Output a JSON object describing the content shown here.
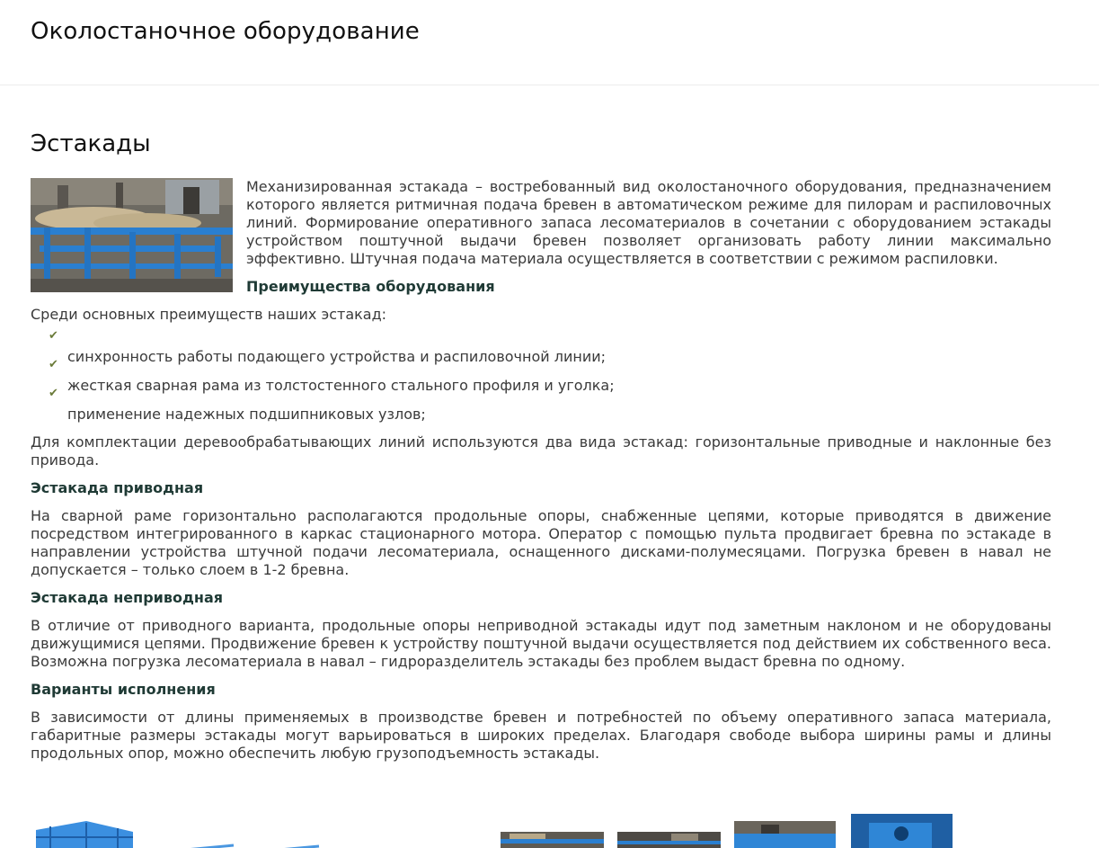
{
  "header": {
    "title": "Околостаночное оборудование"
  },
  "section": {
    "title": "Эстакады",
    "intro": "Механизированная эстакада – востребованный вид околостаночного оборудования, предназначением которого является ритмичная подача бревен в автоматическом режиме для пилорам и распиловочных линий. Формирование оперативного запаса лесоматериалов в сочетании с оборудованием эстакады устройством поштучной выдачи бревен позволяет организовать работу линии максимально эффективно. Штучная подача материала осуществляется в соответствии с режимом распиловки.",
    "advantages_title": "Преимущества оборудования",
    "advantages_lead": "Среди основных преимуществ наших эстакад:",
    "advantages": [
      "синхронность работы подающего устройства и распиловочной линии;",
      "жесткая сварная рама из толстостенного стального профиля и уголка;",
      "применение надежных подшипниковых узлов;"
    ],
    "types_text": "Для комплектации деревообрабатывающих линий используются два вида эстакад: горизонтальные приводные и наклонные без привода.",
    "driven_title": "Эстакада приводная",
    "driven_text": "На сварной раме горизонтально располагаются продольные опоры, снабженные цепями, которые приводятся в движение посредством интегрированного в каркас стационарного мотора. Оператор с помощью пульта продвигает бревна по эстакаде в направлении устройства штучной подачи лесоматериала, оснащенного дисками-полумесяцами. Погрузка бревен в навал не допускается – только слоем в 1-2 бревна.",
    "nondriven_title": "Эстакада неприводная",
    "nondriven_text": "В отличие от приводного варианта, продольные опоры неприводной эстакады идут под заметным наклоном и не оборудованы движущимися цепями. Продвижение бревен к устройству поштучной выдачи осуществляется под действием их собственного веса. Возможна погрузка лесоматериала в навал – гидроразделитель эстакады без проблем выдаст бревна по одному.",
    "variants_title": "Варианты исполнения",
    "variants_text": "В зависимости от длины применяемых в производстве бревен и потребностей по объему оперативного запаса материала, габаритные размеры эстакады могут варьироваться в широких пределах. Благодаря свободе выбора ширины рамы и длины продольных опор, можно обеспечить любую грузоподъемность эстакады."
  },
  "icons": {
    "check": "check-icon"
  },
  "colors": {
    "heading": "#111111",
    "subheading": "#1f3a35",
    "text": "#3a3a3a",
    "check": "#6b7b3a",
    "equipment_blue": "#2a7fd0"
  }
}
